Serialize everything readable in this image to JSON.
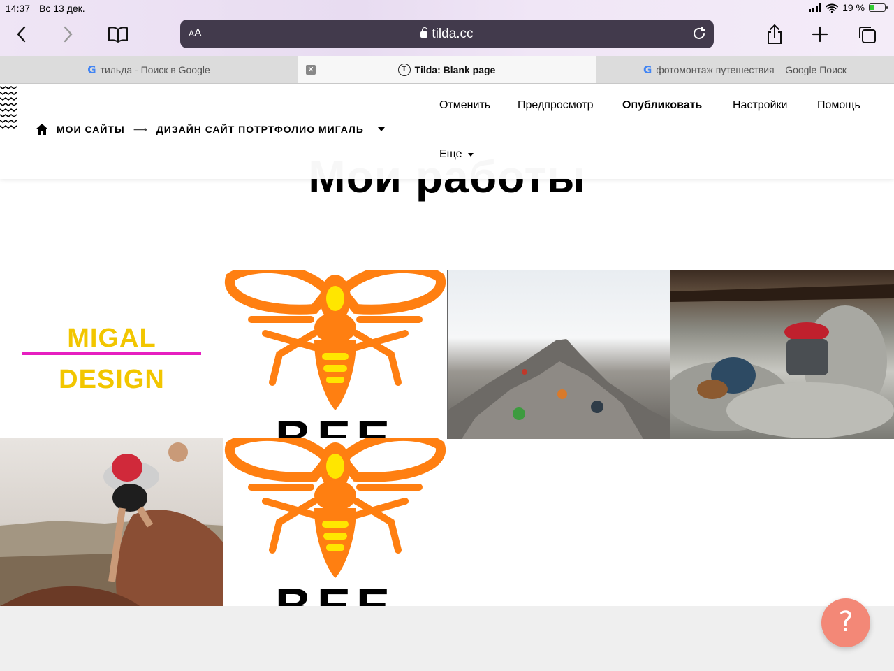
{
  "status_bar": {
    "time": "14:37",
    "date": "Вс 13 дек.",
    "battery": "19 %"
  },
  "browser": {
    "text_size_label": "AA",
    "url": "tilda.cc",
    "tabs": [
      {
        "label": "тильда - Поиск в Google",
        "icon": "google-icon"
      },
      {
        "label": "Tilda: Blank page",
        "icon": "tilda-icon",
        "active": true
      },
      {
        "label": "фотомонтаж путешествия – Google Поиск",
        "icon": "google-icon"
      }
    ]
  },
  "tilda_panel": {
    "menu": {
      "cancel": "Отменить",
      "preview": "Предпросмотр",
      "publish": "Опубликовать",
      "settings": "Настройки",
      "help": "Помощь",
      "more": "Еще"
    },
    "breadcrumbs": {
      "my_sites": "МОИ САЙТЫ",
      "arrow": "⟶",
      "project": "ДИЗАЙН САЙТ ПОТРТФОЛИО МИГАЛЬ"
    }
  },
  "content": {
    "heading": "Мои работы",
    "gallery": {
      "logo_line1": "MIGAL",
      "logo_line2": "DESIGN",
      "bee_caption": "BEE"
    }
  },
  "help_button": {
    "label": "?"
  },
  "colors": {
    "accent_orange": "#ff7f11",
    "bee_yellow": "#ffe600",
    "logo_yellow": "#f2c600",
    "logo_line": "#e61fc0",
    "help_button": "#f38877"
  }
}
